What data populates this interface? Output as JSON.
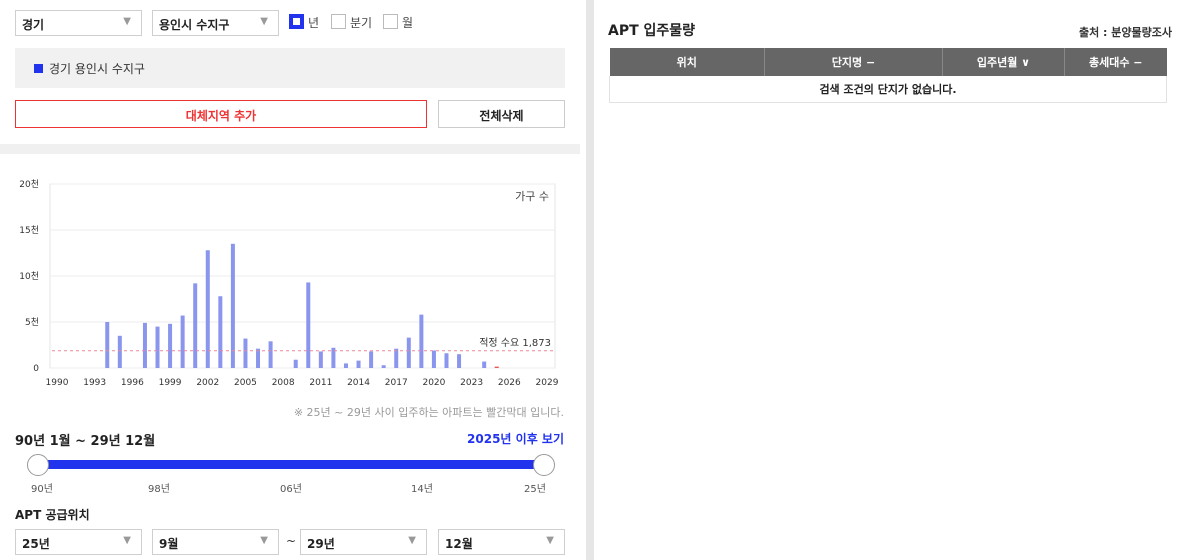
{
  "filters": {
    "province": "경기",
    "city": "용인시 수지구",
    "period_options": [
      {
        "label": "년",
        "checked": true
      },
      {
        "label": "분기",
        "checked": false
      },
      {
        "label": "월",
        "checked": false
      }
    ]
  },
  "selected_region": "경기 용인시 수지구",
  "buttons": {
    "add_region": "대체지역 추가",
    "delete_all": "전체삭제"
  },
  "chart_data": {
    "type": "bar",
    "legend": "가구 수",
    "categories": [
      "1990",
      "1991",
      "1992",
      "1993",
      "1994",
      "1995",
      "1996",
      "1997",
      "1998",
      "1999",
      "2000",
      "2001",
      "2002",
      "2003",
      "2004",
      "2005",
      "2006",
      "2007",
      "2008",
      "2009",
      "2010",
      "2011",
      "2012",
      "2013",
      "2014",
      "2015",
      "2016",
      "2017",
      "2018",
      "2019",
      "2020",
      "2021",
      "2022",
      "2023",
      "2024",
      "2025",
      "2026",
      "2027",
      "2028",
      "2029"
    ],
    "values": [
      0,
      0,
      0,
      0,
      5000,
      3500,
      0,
      4900,
      4500,
      4800,
      5700,
      9200,
      12800,
      7800,
      13500,
      3200,
      2100,
      2900,
      0,
      900,
      9300,
      1800,
      2200,
      500,
      800,
      1800,
      300,
      2100,
      3300,
      5800,
      1900,
      1600,
      1500,
      0,
      700,
      150,
      0,
      0,
      0,
      0
    ],
    "highlight_from": "2025",
    "y_ticks": [
      "0",
      "5천",
      "10천",
      "15천",
      "20천"
    ],
    "ylim": [
      0,
      20000
    ],
    "x_ticks": [
      "1990",
      "1993",
      "1996",
      "1999",
      "2002",
      "2005",
      "2008",
      "2011",
      "2014",
      "2017",
      "2020",
      "2023",
      "2026",
      "2029"
    ],
    "reference": {
      "value": 1873,
      "label": "적정 수요 1,873"
    },
    "colors": {
      "bar": "#8a95ee",
      "highlight": "#e85555",
      "reference": "#ee8899"
    }
  },
  "note": "※ 25년 ~ 29년 사이 입주하는 아파트는 빨간막대 입니다.",
  "range": {
    "title": "90년 1월 ~ 29년 12월",
    "link": "2025년 이후 보기",
    "ticks": [
      "90년",
      "98년",
      "06년",
      "14년",
      "25년"
    ]
  },
  "supply": {
    "title": "APT 공급위치",
    "from_year": "25년",
    "from_month": "9월",
    "to_year": "29년",
    "to_month": "12월",
    "separator": "~"
  },
  "right": {
    "title": "APT 입주물량",
    "source": "출처 : 분양물량조사",
    "columns": [
      "위치",
      "단지명 −",
      "입주년월 ∨",
      "총세대수 −"
    ],
    "empty_message": "검색 조건의 단지가 없습니다."
  },
  "colors": {
    "accent": "#2233ee",
    "danger": "#ee3333"
  }
}
